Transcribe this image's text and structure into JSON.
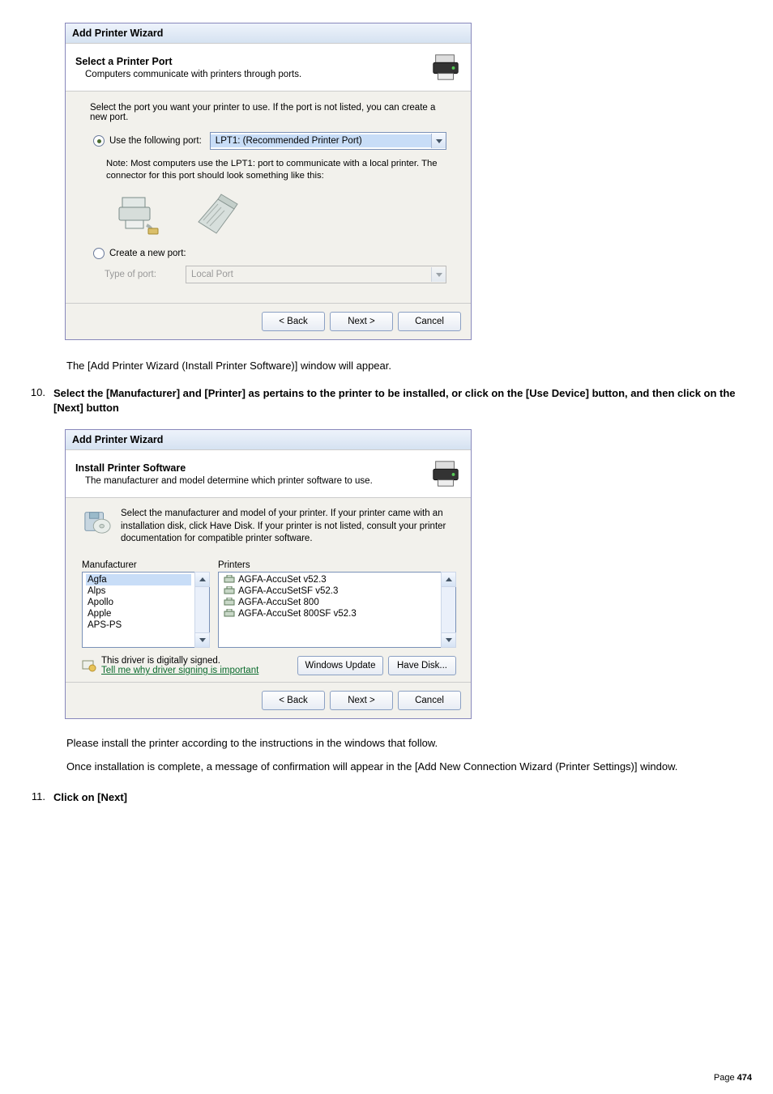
{
  "dialog1": {
    "window_title": "Add Printer Wizard",
    "header_title": "Select a Printer Port",
    "header_sub": "Computers communicate with printers through ports.",
    "intro": "Select the port you want your printer to use.  If the port is not listed, you can create a new port.",
    "use_port_label": "Use the following port:",
    "use_port_value": "LPT1: (Recommended Printer Port)",
    "note": "Note: Most computers use the LPT1: port to communicate with a local printer. The connector for this port should look something like this:",
    "create_port_label": "Create a new port:",
    "type_of_port_label": "Type of port:",
    "type_of_port_value": "Local Port",
    "back": "< Back",
    "next": "Next >",
    "cancel": "Cancel"
  },
  "body1": "The [Add Printer Wizard (Install Printer Software)] window will appear.",
  "step10": {
    "num": "10.",
    "text": "Select the [Manufacturer] and [Printer] as pertains to the printer to be installed, or click on the [Use Device] button, and then click on the [Next] button"
  },
  "dialog2": {
    "window_title": "Add Printer Wizard",
    "header_title": "Install Printer Software",
    "header_sub": "The manufacturer and model determine which printer software to use.",
    "instr": "Select the manufacturer and model of your printer. If your printer came with an installation disk, click Have Disk. If your printer is not listed, consult your printer documentation for compatible printer software.",
    "mfr_label": "Manufacturer",
    "printers_label": "Printers",
    "mfr_items": [
      "Agfa",
      "Alps",
      "Apollo",
      "Apple",
      "APS-PS"
    ],
    "printer_items": [
      "AGFA-AccuSet v52.3",
      "AGFA-AccuSetSF v52.3",
      "AGFA-AccuSet 800",
      "AGFA-AccuSet 800SF v52.3"
    ],
    "signed": "This driver is digitally signed.",
    "tellme": "Tell me why driver signing is important",
    "win_update": "Windows Update",
    "have_disk": "Have Disk...",
    "back": "< Back",
    "next": "Next >",
    "cancel": "Cancel"
  },
  "body2a": "Please install the printer according to the instructions in the windows that follow.",
  "body2b": "Once installation is complete, a message of confirmation will appear in the [Add New Connection Wizard (Printer Settings)] window.",
  "step11": {
    "num": "11.",
    "text": "Click on [Next]"
  },
  "page_label": "Page",
  "page_num": "474"
}
